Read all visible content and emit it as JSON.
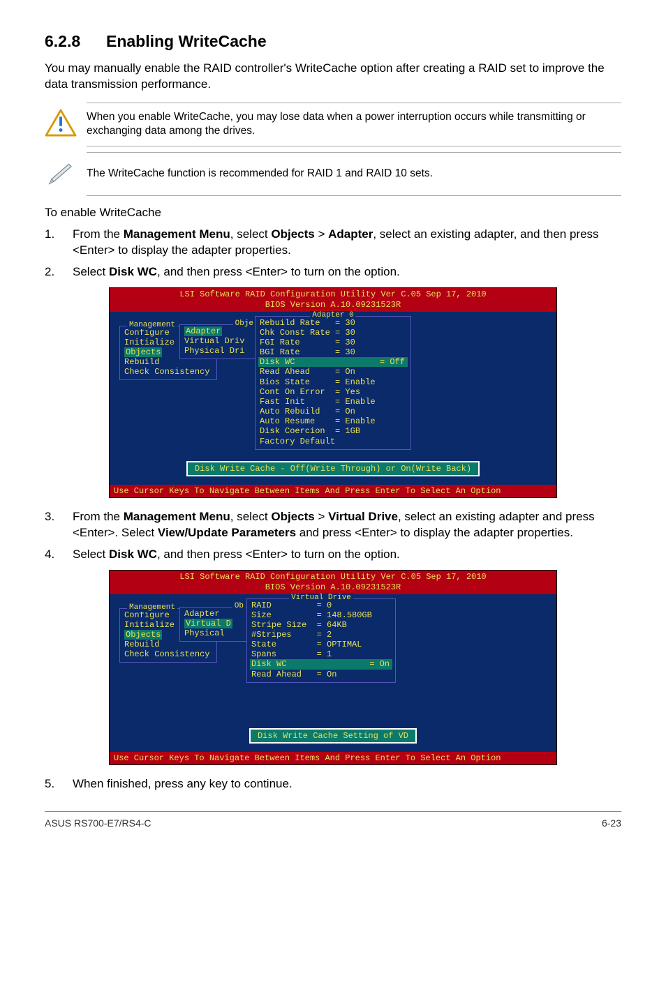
{
  "section": {
    "number": "6.2.8",
    "title": "Enabling WriteCache"
  },
  "intro": "You may manually enable the RAID controller's WriteCache option after creating a RAID set to improve the data transmission performance.",
  "callout_warning": "When you enable WriteCache, you may lose data when a power interruption occurs while transmitting or exchanging data among the drives.",
  "callout_note": "The WriteCache function is recommended for RAID 1 and RAID 10 sets.",
  "subhead": "To enable WriteCache",
  "steps": {
    "s1_pre": "From the ",
    "s1_b1": "Management Menu",
    "s1_mid1": ", select ",
    "s1_b2": "Objects",
    "s1_gt": " > ",
    "s1_b3": "Adapter",
    "s1_post": ", select an existing adapter, and then press <Enter> to display the adapter properties.",
    "s2_pre": "Select ",
    "s2_b1": "Disk WC",
    "s2_post": ", and then press <Enter> to turn on the option.",
    "s3_pre": "From the ",
    "s3_b1": "Management Menu",
    "s3_mid1": ", select ",
    "s3_b2": "Objects",
    "s3_gt": " > ",
    "s3_b3": "Virtual Drive",
    "s3_mid2": ", select an existing adapter and press <Enter>. Select ",
    "s3_b4": "View/Update Parameters",
    "s3_post": " and press <Enter> to display the adapter properties.",
    "s4_pre": "Select ",
    "s4_b1": "Disk WC",
    "s4_post": ", and then press <Enter> to turn on the option.",
    "s5": "When finished, press any key to continue."
  },
  "bios_common": {
    "header_line1": "LSI Software RAID Configuration Utility Ver C.05 Sep 17, 2010",
    "header_line2": "BIOS Version   A.10.09231523R",
    "footer": "Use Cursor Keys To Navigate Between Items And Press Enter To Select An Option",
    "mgmt_title": "Management",
    "mgmt_items": [
      "Configure",
      "Initialize",
      "Objects",
      "Rebuild",
      "Check Consistency"
    ]
  },
  "bios1": {
    "submenu_title": "Obje",
    "submenu_items": [
      "Adapter",
      "Virtual Driv",
      "Physical Dri"
    ],
    "props_title": "Adapter 0",
    "rows": [
      {
        "k": "Rebuild Rate",
        "v": "= 30"
      },
      {
        "k": "Chk Const Rate",
        "v": "= 30"
      },
      {
        "k": "FGI Rate",
        "v": "= 30"
      },
      {
        "k": "BGI Rate",
        "v": "= 30"
      },
      {
        "k": "Disk WC",
        "v": "= Off",
        "hl": true
      },
      {
        "k": "Read Ahead",
        "v": "= On"
      },
      {
        "k": "Bios State",
        "v": "= Enable"
      },
      {
        "k": "Cont On Error",
        "v": "= Yes"
      },
      {
        "k": "Fast Init",
        "v": "= Enable"
      },
      {
        "k": "Auto Rebuild",
        "v": "= On"
      },
      {
        "k": "Auto Resume",
        "v": "= Enable"
      },
      {
        "k": "Disk Coercion",
        "v": "= 1GB"
      },
      {
        "k": "Factory Default",
        "v": ""
      }
    ],
    "msg": "Disk Write Cache - Off(Write Through) or On(Write Back)"
  },
  "bios2": {
    "submenu_title": "Ob",
    "submenu_items": [
      "Adapter",
      "Virtual D",
      "Physical"
    ],
    "props_title": "Virtual Drive",
    "rows": [
      {
        "k": "RAID",
        "v": "= 0"
      },
      {
        "k": "Size",
        "v": "= 148.580GB"
      },
      {
        "k": "Stripe Size",
        "v": "= 64KB"
      },
      {
        "k": "#Stripes",
        "v": "= 2"
      },
      {
        "k": "State",
        "v": "= OPTIMAL"
      },
      {
        "k": "Spans",
        "v": "= 1"
      },
      {
        "k": "Disk WC",
        "v": "= On",
        "hl": true
      },
      {
        "k": "Read Ahead",
        "v": "= On"
      }
    ],
    "msg": "Disk Write Cache Setting of VD"
  },
  "footer": {
    "left": "ASUS RS700-E7/RS4-C",
    "right": "6-23"
  }
}
